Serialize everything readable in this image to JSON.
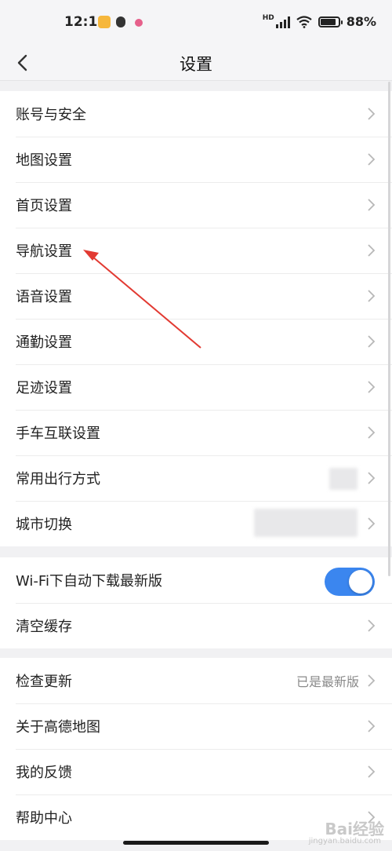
{
  "status_bar": {
    "time": "12:10",
    "network": "HD",
    "battery": "88%",
    "battery_level": 0.88
  },
  "header": {
    "title": "设置",
    "back_icon": "chevron-left-icon"
  },
  "groups": [
    {
      "items": [
        {
          "label": "账号与安全"
        },
        {
          "label": "地图设置"
        },
        {
          "label": "首页设置"
        },
        {
          "label": "导航设置"
        },
        {
          "label": "语音设置"
        },
        {
          "label": "通勤设置"
        },
        {
          "label": "足迹设置"
        },
        {
          "label": "手车互联设置"
        },
        {
          "label": "常用出行方式"
        },
        {
          "label": "城市切换"
        }
      ]
    },
    {
      "items": [
        {
          "label": "Wi-Fi下自动下载最新版",
          "toggle_on": true
        },
        {
          "label": "清空缓存"
        }
      ]
    },
    {
      "items": [
        {
          "label": "检查更新",
          "value": "已是最新版"
        },
        {
          "label": "关于高德地图"
        },
        {
          "label": "我的反馈"
        },
        {
          "label": "帮助中心"
        }
      ]
    }
  ],
  "colors": {
    "toggle_on": "#3b86ef",
    "annotation_arrow": "#e23a32"
  },
  "watermark": {
    "text": "Bai经验",
    "sub": "jingyan.baidu.com"
  }
}
